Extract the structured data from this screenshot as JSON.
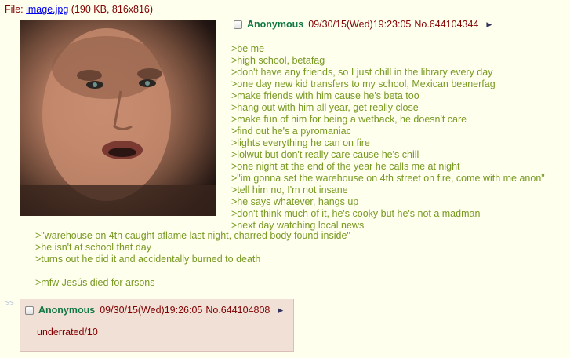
{
  "file": {
    "prefix": "File:",
    "filename": "image.jpg",
    "meta": "(190 KB, 816x816)"
  },
  "op": {
    "name": "Anonymous",
    "datetime": "09/30/15(Wed)19:23:05",
    "postnum": "No.644104344",
    "menu_icon": "triangle-right-icon",
    "lines_right": [
      ">be me",
      ">high school, betafag",
      ">don't have any friends, so I just chill in the library every day",
      ">one day new kid transfers to my school, Mexican beanerfag",
      ">make friends with him cause he's beta too",
      ">hang out with him all year, get really close",
      ">make fun of him for being a wetback, he doesn't care",
      ">find out he's a pyromaniac",
      ">lights everything he can on fire",
      ">lolwut but don't really care cause he's chill",
      ">one night at the end of the year he calls me at night",
      ">\"im gonna set the warehouse on 4th street on fire, come with me anon\"",
      ">tell him no, I'm not insane",
      ">he says whatever, hangs up",
      ">don't think much of it, he's cooky but he's not a madman",
      ">next day watching local news"
    ],
    "lines_wrap": [
      ">\"warehouse on 4th caught aflame last night, charred body found inside\"",
      ">he isn't at school that day",
      ">turns out he did it and accidentally burned to death"
    ],
    "mfw": ">mfw Jesús died for arsons"
  },
  "reply": {
    "arrows": ">>",
    "name": "Anonymous",
    "datetime": "09/30/15(Wed)19:26:05",
    "postnum": "No.644104808",
    "menu_icon": "triangle-right-icon",
    "text": "underrated/10"
  },
  "colors": {
    "background": "#ffffee",
    "reply_background": "#f0e0d6",
    "name": "#117743",
    "greentext": "#789922",
    "text": "#800000",
    "link": "#0000ee"
  }
}
